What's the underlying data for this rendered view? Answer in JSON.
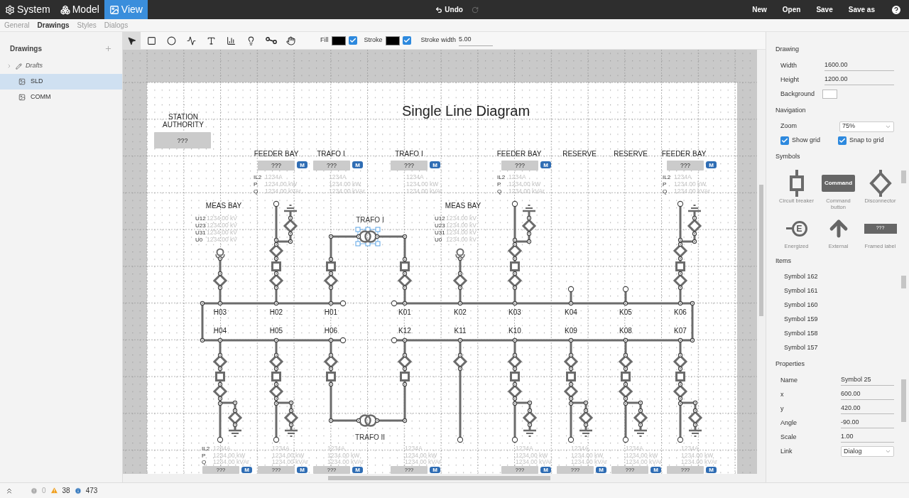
{
  "menu_tabs": [
    {
      "label": "System",
      "selected": false
    },
    {
      "label": "Model",
      "selected": false
    },
    {
      "label": "View",
      "selected": true
    }
  ],
  "history": {
    "undo": "Undo",
    "redo_disabled": true
  },
  "file_actions": [
    "New",
    "Open",
    "Save",
    "Save as"
  ],
  "sub_tabs": [
    {
      "label": "General",
      "selected": false
    },
    {
      "label": "Drawings",
      "selected": true
    },
    {
      "label": "Styles",
      "selected": false
    },
    {
      "label": "Dialogs",
      "selected": false
    }
  ],
  "sidebar": {
    "title": "Drawings",
    "items": [
      {
        "label": "Drafts",
        "kind": "folder",
        "selected": false,
        "expanded": false
      },
      {
        "label": "SLD",
        "kind": "drawing",
        "selected": true
      },
      {
        "label": "COMM",
        "kind": "drawing",
        "selected": false
      }
    ]
  },
  "toolbar": {
    "tools": [
      {
        "kind": "select",
        "selected": true
      },
      {
        "kind": "rectangle",
        "selected": false
      },
      {
        "kind": "ellipse",
        "selected": false
      },
      {
        "kind": "polyline",
        "selected": false
      },
      {
        "kind": "text",
        "selected": false
      },
      {
        "kind": "chart",
        "selected": false
      },
      {
        "kind": "bulb",
        "selected": false
      },
      {
        "kind": "connector",
        "selected": false
      },
      {
        "kind": "pan",
        "selected": false
      }
    ],
    "fill": {
      "label": "Fill",
      "color": "#000000",
      "checked": true
    },
    "stroke": {
      "label": "Stroke",
      "color": "#000000",
      "checked": true
    },
    "stroke_width": {
      "label": "Stroke width",
      "value": "5.00"
    }
  },
  "diagram": {
    "title": "Single Line Diagram",
    "station": {
      "lines": [
        "STATION",
        "AUTHORITY"
      ],
      "value": "???"
    },
    "top_bays": [
      {
        "label": "FEEDER BAY",
        "value": "???",
        "badge": "M",
        "measurements": [
          {
            "name": "IL2",
            "value": "1234A"
          },
          {
            "name": "P",
            "value": "1234.00 kW"
          },
          {
            "name": "Q",
            "value": "1234.00 kVAr"
          }
        ]
      },
      {
        "label": "TRAFO I",
        "value": "???",
        "badge": "M",
        "measurements": [
          {
            "value": "1234A"
          },
          {
            "value": "1234.00 kW"
          },
          {
            "value": "1234.00 kVAr"
          }
        ]
      },
      {
        "label": "TRAFO I",
        "value": "???",
        "badge": "M",
        "measurements": [
          {
            "value": "1234A"
          },
          {
            "value": "1234.00 kW"
          },
          {
            "value": "1234.00 kVAr"
          }
        ]
      },
      {
        "label": "FEEDER BAY",
        "value": "???",
        "badge": "M",
        "measurements": [
          {
            "name": "IL2",
            "value": "1234A"
          },
          {
            "name": "P",
            "value": "1234.00 kW"
          },
          {
            "name": "Q",
            "value": "1234.00 kVAr"
          }
        ]
      },
      {
        "label": "RESERVE"
      },
      {
        "label": "RESERVE"
      },
      {
        "label": "FEEDER BAY",
        "value": "???",
        "badge": "M",
        "measurements": [
          {
            "name": "IL2",
            "value": "1234A"
          },
          {
            "name": "P",
            "value": "1234.00 kW"
          },
          {
            "name": "Q",
            "value": "1234.00 kVAr"
          }
        ]
      }
    ],
    "meas_bays": [
      {
        "label": "MEAS BAY",
        "readings": [
          {
            "name": "U12",
            "value": "1234.00 kV"
          },
          {
            "name": "U23",
            "value": "1234.00 kV"
          },
          {
            "name": "U31",
            "value": "1234.00 kV"
          },
          {
            "name": "U0",
            "value": "1234.00 kV"
          }
        ]
      },
      {
        "label": "MEAS BAY",
        "readings": [
          {
            "name": "U12",
            "value": "1234.00 kV"
          },
          {
            "name": "U23",
            "value": "1234.00 kV"
          },
          {
            "name": "U31",
            "value": "1234.00 kV"
          },
          {
            "name": "U0",
            "value": "1234.00 kV"
          }
        ]
      }
    ],
    "busbars": {
      "upper": [
        "H03",
        "H02",
        "H01",
        "K01",
        "K02",
        "K03",
        "K04",
        "K05",
        "K06"
      ],
      "lower": [
        "H04",
        "H05",
        "H06",
        "K12",
        "K11",
        "K10",
        "K09",
        "K08",
        "K07"
      ]
    },
    "upper_feeders": [
      {
        "kind": "measuring"
      },
      {
        "kind": "feeder"
      },
      {
        "kind": "transformer"
      },
      {
        "kind": "transformer"
      },
      {
        "kind": "measuring"
      },
      {
        "kind": "feeder"
      },
      {
        "kind": "stub"
      },
      {
        "kind": "stub"
      },
      {
        "kind": "feeder"
      }
    ],
    "lower_feeders": [
      {
        "kind": "feeder"
      },
      {
        "kind": "feeder"
      },
      {
        "kind": "transformer"
      },
      {
        "kind": "transformer"
      },
      {
        "kind": "line"
      },
      {
        "kind": "feeder"
      },
      {
        "kind": "feeder"
      },
      {
        "kind": "feeder"
      },
      {
        "kind": "feeder"
      }
    ],
    "transformers": [
      {
        "label": "TRAFO I",
        "selected": true
      },
      {
        "label": "TRAFO II",
        "selected": false
      }
    ],
    "bottom_bays": [
      {
        "value": "???",
        "badge": "M",
        "measurements": [
          {
            "name": "IL2",
            "value": "1234A"
          },
          {
            "name": "P",
            "value": "1234.00 kW"
          },
          {
            "name": "Q",
            "value": "1234.00 kVAr"
          }
        ]
      },
      {
        "value": "???",
        "badge": "M",
        "measurements": [
          {
            "value": "1234A"
          },
          {
            "value": "1234.00 kW"
          },
          {
            "value": "1234.00 kVAr"
          }
        ]
      },
      {
        "value": "???",
        "badge": "M",
        "measurements": [
          {
            "value": "1234A"
          },
          {
            "value": "1234.00 kW"
          },
          {
            "value": "1234.00 kVAr"
          }
        ]
      },
      {
        "value": "???",
        "badge": "M",
        "measurements": [
          {
            "value": "1234A"
          },
          {
            "value": "1234.00 kW"
          },
          {
            "value": "1234.00 kVAr"
          }
        ]
      },
      {
        "value": "???",
        "badge": "M",
        "measurements": [
          {
            "value": "1234A"
          },
          {
            "value": "1234.00 kW"
          },
          {
            "value": "1234.00 kVAr"
          }
        ]
      },
      {
        "value": "???",
        "badge": "M",
        "measurements": [
          {
            "value": "1234A"
          },
          {
            "value": "1234.00 kW"
          },
          {
            "value": "1234.00 kVAr"
          }
        ]
      },
      {
        "value": "???",
        "badge": "M",
        "measurements": [
          {
            "value": "1234A"
          },
          {
            "value": "1234.00 kW"
          },
          {
            "value": "1234.00 kVAr"
          }
        ]
      },
      {
        "value": "???",
        "badge": "M",
        "measurements": [
          {
            "value": "1234A"
          },
          {
            "value": "1234.00 kW"
          },
          {
            "value": "1234.00 kVAr"
          }
        ]
      }
    ]
  },
  "panel": {
    "drawing": {
      "title": "Drawing",
      "fields": [
        {
          "label": "Width",
          "value": "1600.00"
        },
        {
          "label": "Height",
          "value": "1200.00"
        }
      ],
      "background": {
        "label": "Background",
        "color": "#ffffff"
      }
    },
    "navigation": {
      "title": "Navigation",
      "zoom": {
        "label": "Zoom",
        "value": "75%"
      },
      "show_grid": {
        "label": "Show grid",
        "checked": true
      },
      "snap_to_grid": {
        "label": "Snap to grid",
        "checked": true
      }
    },
    "symbols": {
      "title": "Symbols",
      "items": [
        {
          "kind": "circuit_breaker",
          "label": "Circuit breaker"
        },
        {
          "kind": "command_button",
          "label": "Command button",
          "text": "Command"
        },
        {
          "kind": "disconnector",
          "label": "Disconnector"
        },
        {
          "kind": "energized",
          "label": "Energized",
          "text": "E"
        },
        {
          "kind": "external",
          "label": "External"
        },
        {
          "kind": "framed_label",
          "label": "Framed label",
          "text": "???"
        }
      ]
    },
    "items": {
      "title": "Items",
      "entries": [
        "Symbol 162",
        "Symbol 161",
        "Symbol 160",
        "Symbol 159",
        "Symbol 158",
        "Symbol 157"
      ]
    },
    "properties": {
      "title": "Properties",
      "fields": [
        {
          "label": "Name",
          "value": "Symbol 25",
          "kind": "text"
        },
        {
          "label": "x",
          "value": "600.00",
          "kind": "text"
        },
        {
          "label": "y",
          "value": "420.00",
          "kind": "text"
        },
        {
          "label": "Angle",
          "value": "-90.00",
          "kind": "text"
        },
        {
          "label": "Scale",
          "value": "1.00",
          "kind": "text"
        },
        {
          "label": "Link",
          "value": "Dialog",
          "kind": "select"
        }
      ]
    }
  },
  "status": {
    "errors": "0",
    "warnings": "38",
    "infos": "473"
  }
}
